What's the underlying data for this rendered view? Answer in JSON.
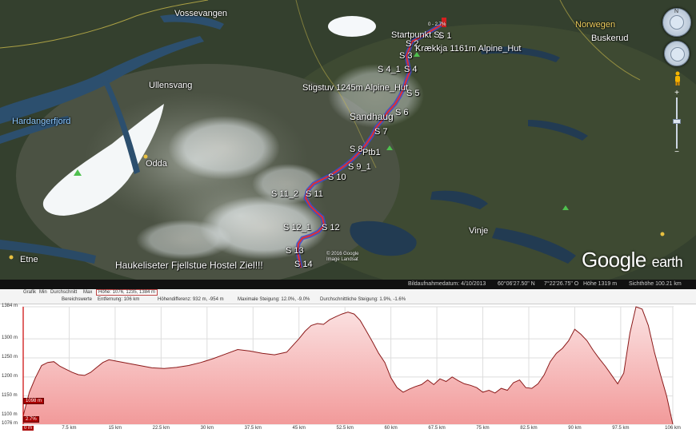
{
  "map": {
    "places": [
      {
        "name": "Vossevangen",
        "style": ""
      },
      {
        "name": "Ullensvang",
        "style": ""
      },
      {
        "name": "Hardangerfjord",
        "style": "blue"
      },
      {
        "name": "Odda",
        "style": ""
      },
      {
        "name": "Etne",
        "style": ""
      },
      {
        "name": "Vinje",
        "style": ""
      },
      {
        "name": "Norwegen",
        "style": "yellow"
      },
      {
        "name": "Buskerud",
        "style": ""
      }
    ],
    "waypoints": [
      "Startpunkt St",
      "S 1",
      "S 2",
      "S 3",
      "Krækkja 1161m Alpine_Hut",
      "S 4_1",
      "S 4",
      "Stigstuv 1245m Alpine_Hut",
      "S 5",
      "S 6",
      "Sandhaug",
      "S 7",
      "S 8",
      "Ptb1",
      "S 9_1",
      "S 10",
      "S 11_2",
      "S 11",
      "S 12_1",
      "S 12",
      "S 13",
      "Haukeliseter Fjellstue Hostel Ziel!!!",
      "S 14"
    ],
    "top_marker": "0 - 2.7%",
    "copyright": [
      "© 2016 Google",
      "Image Landsat"
    ],
    "logo": {
      "google": "Google",
      "earth": "earth"
    },
    "nav": {
      "north": "N"
    },
    "status": {
      "date": "Bildaufnahmedatum: 4/10/2013",
      "lat": "60°06'27.50\" N",
      "lon": "7°22'26.75\" O",
      "height": "Höhe 1319 m",
      "eye": "Sichthöhe 100.21 km"
    }
  },
  "profile": {
    "header": {
      "graph_label": "Grafik",
      "min_label": "Min",
      "avg_label": "Durchschnitt",
      "max_label": "Max",
      "height_value": "Höhe: 1076, 1235, 1384 m",
      "range_label": "Bereichswerte",
      "distance": "Entfernung: 106 km",
      "height_diff": "Höhendifferenz: 932 m, -954 m",
      "max_slope": "Maximale Steigung: 12.0%, -9.0%",
      "avg_slope": "Durchschnittliche Steigung: 1.9%, -1.6%"
    },
    "cursor_labels": {
      "height": "1098 m",
      "slope": "2.7%",
      "distance": "0 m"
    }
  },
  "chart_data": {
    "type": "area",
    "xlabel": "",
    "ylabel": "",
    "x_unit": "km",
    "y_unit": "m",
    "xlim": [
      0,
      106
    ],
    "ylim": [
      1076,
      1384
    ],
    "y_ticks": [
      "1384 m",
      "1300 m",
      "1250 m",
      "1200 m",
      "1150 m",
      "1100 m",
      "1076 m"
    ],
    "y_tick_values": [
      1384,
      1300,
      1250,
      1200,
      1150,
      1100,
      1076
    ],
    "x_ticks": [
      "0 m",
      "7.5 km",
      "15 km",
      "22.5 km",
      "30 km",
      "37.5 km",
      "45 km",
      "52.5 km",
      "60 km",
      "67.5 km",
      "75 km",
      "82.5 km",
      "90 km",
      "97.5 km",
      "106 km"
    ],
    "x_tick_values": [
      0,
      7.5,
      15,
      22.5,
      30,
      37.5,
      45,
      52.5,
      60,
      67.5,
      75,
      82.5,
      90,
      97.5,
      106
    ],
    "series": [
      {
        "name": "Höhe",
        "color": "#8b1a1a",
        "fill": "#f7c8c8",
        "x": [
          0,
          1,
          2,
          3,
          4,
          5,
          6,
          7,
          8,
          9,
          10,
          11,
          12,
          13,
          14,
          15,
          17,
          19,
          21,
          23,
          25,
          27,
          29,
          31,
          33,
          35,
          37,
          39,
          41,
          43,
          45,
          46,
          47,
          48,
          49,
          50,
          51,
          52,
          53,
          54,
          55,
          56,
          57,
          58,
          59,
          60,
          61,
          62,
          63,
          64,
          65,
          66,
          67,
          68,
          69,
          70,
          71,
          72,
          73,
          74,
          75,
          76,
          77,
          78,
          79,
          80,
          81,
          82,
          83,
          84,
          85,
          86,
          87,
          88,
          89,
          90,
          91,
          92,
          93,
          94,
          95,
          96,
          97,
          98,
          99,
          100,
          101,
          102,
          103,
          104,
          105,
          106
        ],
        "y": [
          1098,
          1160,
          1198,
          1230,
          1238,
          1240,
          1228,
          1220,
          1212,
          1206,
          1204,
          1212,
          1225,
          1238,
          1245,
          1242,
          1236,
          1230,
          1224,
          1222,
          1225,
          1230,
          1238,
          1248,
          1260,
          1272,
          1268,
          1262,
          1258,
          1265,
          1300,
          1320,
          1335,
          1340,
          1338,
          1350,
          1358,
          1365,
          1370,
          1365,
          1348,
          1320,
          1292,
          1262,
          1238,
          1198,
          1172,
          1160,
          1168,
          1175,
          1180,
          1192,
          1180,
          1195,
          1188,
          1200,
          1190,
          1182,
          1178,
          1172,
          1160,
          1165,
          1158,
          1170,
          1165,
          1185,
          1192,
          1172,
          1170,
          1182,
          1205,
          1240,
          1262,
          1275,
          1295,
          1325,
          1312,
          1295,
          1270,
          1248,
          1228,
          1205,
          1182,
          1210,
          1315,
          1384,
          1378,
          1335,
          1265,
          1205,
          1150,
          1076
        ]
      }
    ]
  }
}
